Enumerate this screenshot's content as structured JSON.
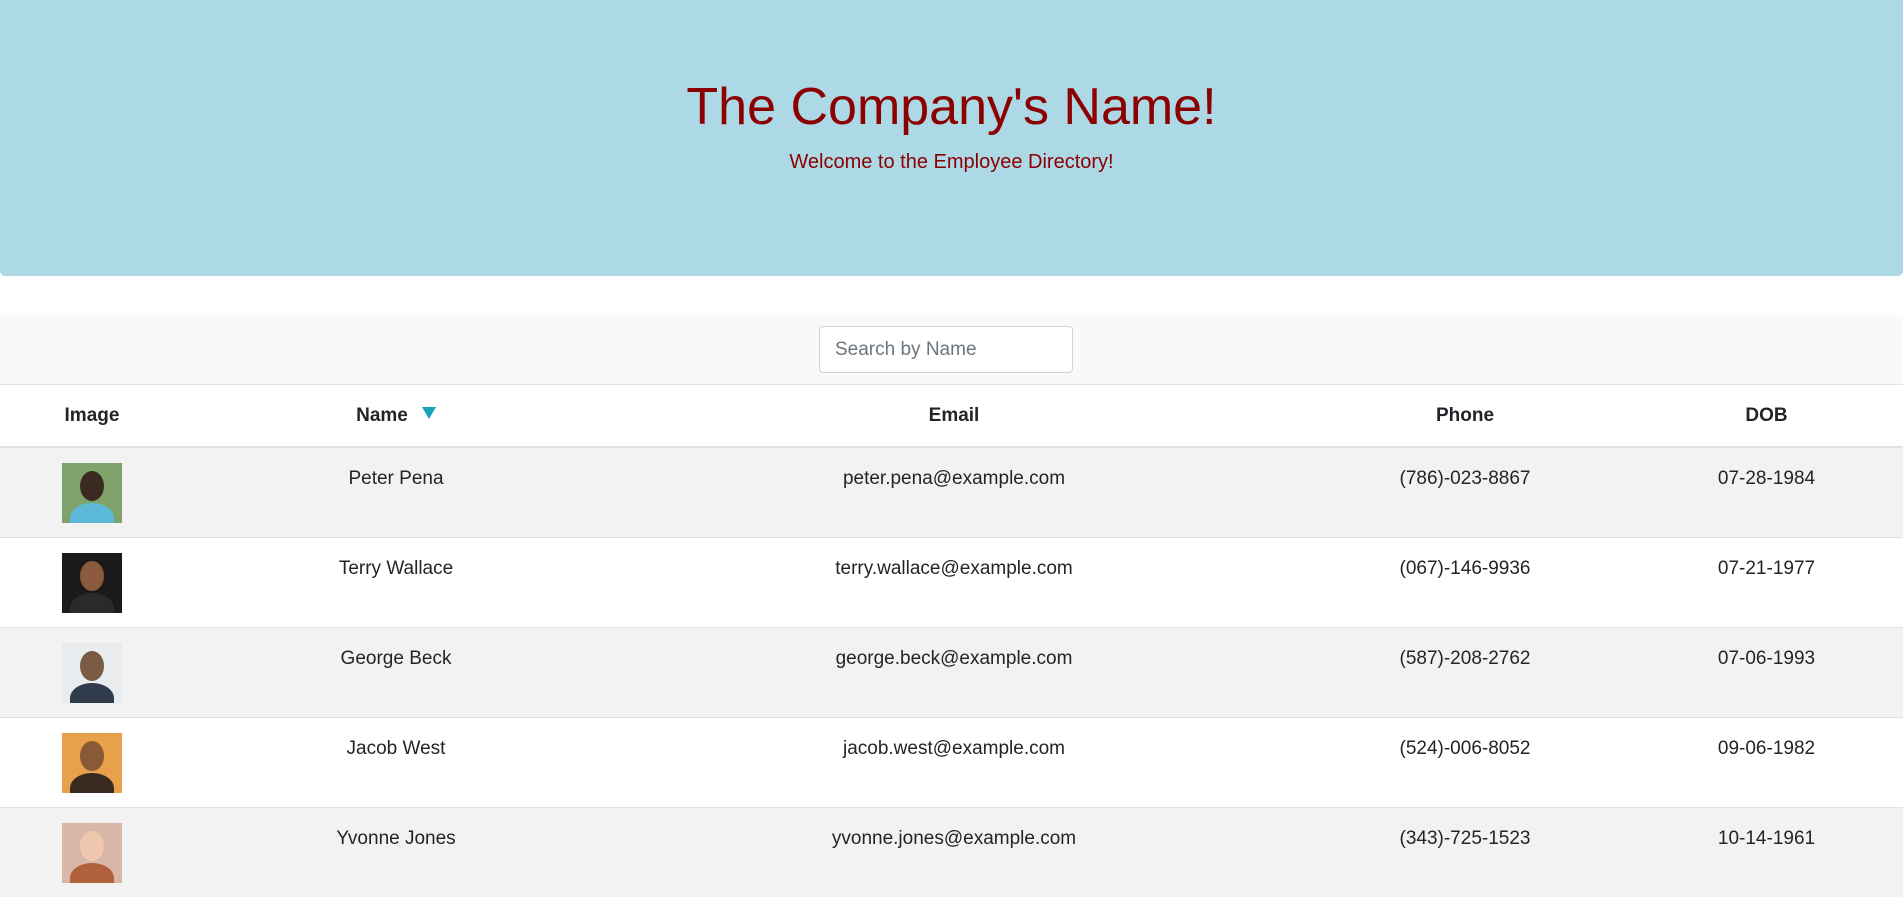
{
  "header": {
    "title": "The Company's Name!",
    "subtitle": "Welcome to the Employee Directory!"
  },
  "search": {
    "placeholder": "Search by Name",
    "value": ""
  },
  "table": {
    "columns": [
      "Image",
      "Name",
      "Email",
      "Phone",
      "DOB"
    ],
    "sort_icon": "sort-down-triangle-icon",
    "sort_color": "#17a2b8",
    "rows": [
      {
        "name": "Peter Pena",
        "email": "peter.pena@example.com",
        "phone": "(786)-023-8867",
        "dob": "07-28-1984",
        "avatar": "avatar-photo"
      },
      {
        "name": "Terry Wallace",
        "email": "terry.wallace@example.com",
        "phone": "(067)-146-9936",
        "dob": "07-21-1977",
        "avatar": "avatar-photo"
      },
      {
        "name": "George Beck",
        "email": "george.beck@example.com",
        "phone": "(587)-208-2762",
        "dob": "07-06-1993",
        "avatar": "avatar-photo"
      },
      {
        "name": "Jacob West",
        "email": "jacob.west@example.com",
        "phone": "(524)-006-8052",
        "dob": "09-06-1982",
        "avatar": "avatar-photo"
      },
      {
        "name": "Yvonne Jones",
        "email": "yvonne.jones@example.com",
        "phone": "(343)-725-1523",
        "dob": "10-14-1961",
        "avatar": "avatar-photo"
      }
    ]
  },
  "colors": {
    "hero_background": "#add8e6",
    "title_color": "#8b0000",
    "stripe": "#f2f2f2"
  }
}
